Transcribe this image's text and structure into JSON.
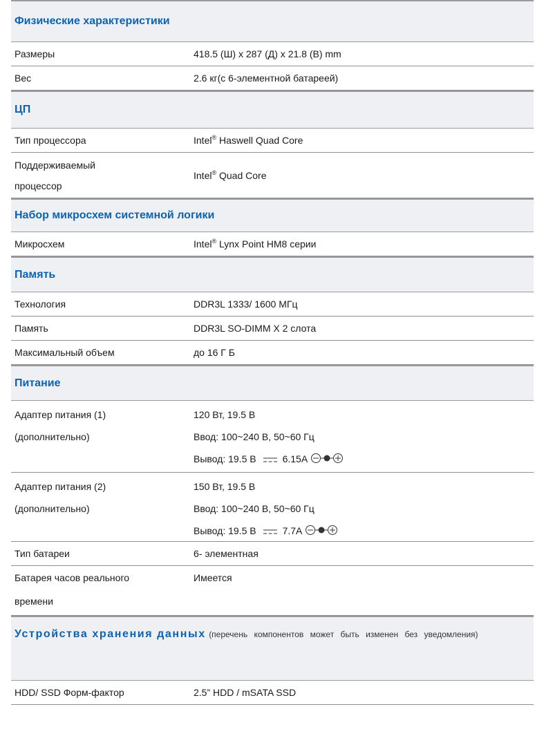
{
  "sections": [
    {
      "title": "Физические характеристики"
    },
    {
      "title": "ЦП"
    },
    {
      "title": "Набор микросхем системной логики"
    },
    {
      "title": "Память"
    },
    {
      "title": "Питание"
    },
    {
      "title": "Устройства хранения данных",
      "note": "(перечень компонентов может быть изменен без уведомления)"
    }
  ],
  "physical": {
    "size_label": "Размеры",
    "size_value": "418.5 (Ш) x 287 (Д) x 21.8 (В) mm",
    "weight_label": "Вес",
    "weight_value": "2.6 кг(с 6-элементной батареей)"
  },
  "cpu": {
    "type_label": "Тип процессора",
    "brand": "Intel",
    "reg_mark": "®",
    "type_value": " Haswell Quad Core",
    "supported_label_1": "Поддерживаемый",
    "supported_label_2": "процессор",
    "supported_value": " Quad Core"
  },
  "chipset": {
    "label": "Микросхем",
    "value": " Lynx Point HM8 серии"
  },
  "memory": {
    "tech_label": "Технология",
    "tech_value": "DDR3L 1333/ 1600 МГц",
    "slots_label": "Память",
    "slots_value": "DDR3L SO-DIMM X 2 слота",
    "max_label": "Максимальный объем",
    "max_value": "до 16 Г Б"
  },
  "power": {
    "adapter1": {
      "label_1": "Адаптер питания (1)",
      "label_2": "(дополнительно)",
      "rating": "120 Вт, 19.5 В",
      "input": "Ввод: 100~240 В, 50~60 Гц",
      "output_prefix": "Вывод: 19.5 В",
      "output_current": "6.15A"
    },
    "adapter2": {
      "label_1": "Адаптер питания (2)",
      "label_2": "(дополнительно)",
      "rating": "150 Вт, 19.5 В",
      "input": "Ввод: 100~240 В, 50~60 Гц",
      "output_prefix": "Вывод: 19.5 В",
      "output_current": "7.7A"
    },
    "battery_label": "Тип батареи",
    "battery_value": "6- элементная",
    "rtc_label_1": "Батарея часов реального",
    "rtc_label_2": "времени",
    "rtc_value": "Имеется"
  },
  "storage": {
    "label": "HDD/ SSD Форм-фактор",
    "value": "2.5” HDD / mSATA SSD"
  },
  "icons": [
    "dc-symbol-icon",
    "polarity-icon"
  ],
  "colors": {
    "heading": "#0d63b3",
    "section_bg": "#eef0f3",
    "rule": "#9a9a9a"
  }
}
